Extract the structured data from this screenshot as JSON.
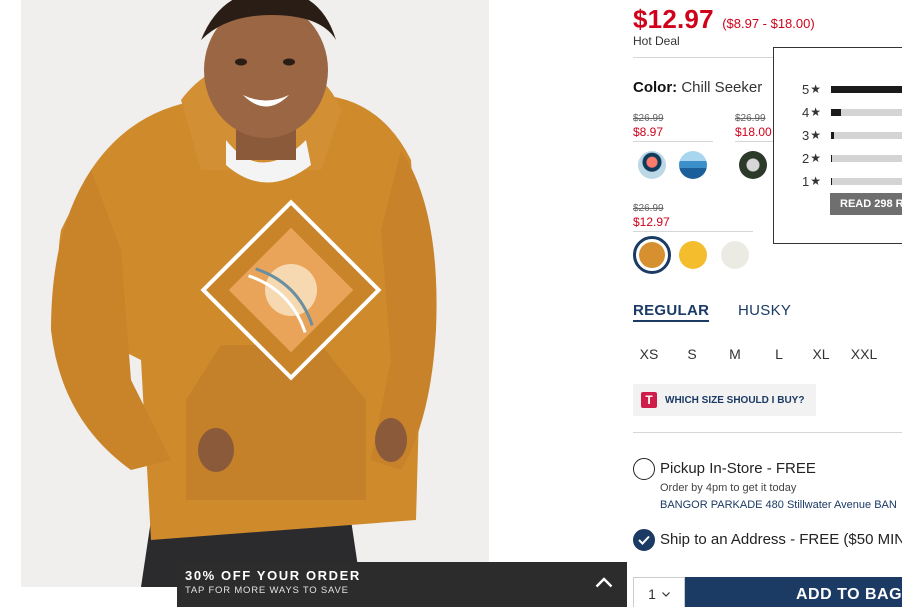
{
  "price": {
    "current": "$12.97",
    "range": "($8.97 - $18.00)",
    "badge": "Hot Deal"
  },
  "color": {
    "label": "Color:",
    "selected": "Chill Seeker",
    "groups": [
      {
        "was": "$26.99",
        "now": "$8.97",
        "swatches": [
          "palm-graphic",
          "blue-stripes"
        ]
      },
      {
        "was": "$26.99",
        "now": "$18.00",
        "swatches": [
          "navy-graphic"
        ]
      },
      {
        "was": "$26.99",
        "now": "$12.97",
        "swatches": [
          "chill-seeker-orange",
          "yellow",
          "cream"
        ]
      }
    ],
    "colors": {
      "chill_seeker_orange": "#d69030",
      "yellow": "#f3bd2d",
      "cream": "#ecebe3",
      "blue_stripes": "#3d8fc9"
    }
  },
  "ratings": {
    "rows": [
      {
        "stars": "5",
        "fraction": 0.85
      },
      {
        "stars": "4",
        "fraction": 0.11
      },
      {
        "stars": "3",
        "fraction": 0.03
      },
      {
        "stars": "2",
        "fraction": 0.01
      },
      {
        "stars": "1",
        "fraction": 0.01
      }
    ],
    "star_glyph": "★",
    "read_label": "READ 298 R"
  },
  "fit": {
    "tabs": [
      {
        "label": "REGULAR",
        "active": true
      },
      {
        "label": "HUSKY",
        "active": false
      }
    ]
  },
  "sizes": [
    "XS",
    "S",
    "M",
    "L",
    "XL",
    "XXL"
  ],
  "size_guide": {
    "icon": "T",
    "label": "WHICH SIZE SHOULD I BUY?"
  },
  "fulfillment": {
    "pickup_label": "Pickup In-Store - FREE",
    "pickup_note": "Order by 4pm to get it today",
    "pickup_store": "BANGOR PARKADE 480 Stillwater Avenue  BAN",
    "ship_label": "Ship to an Address - FREE ($50 MIN"
  },
  "cart": {
    "quantity": "1",
    "add_label": "ADD TO BAG"
  },
  "promo": {
    "title": "30% OFF YOUR ORDER",
    "subtitle": "TAP FOR MORE WAYS TO SAVE"
  },
  "accent": {
    "sale_red": "#d0021b",
    "navy": "#1b3a64"
  }
}
